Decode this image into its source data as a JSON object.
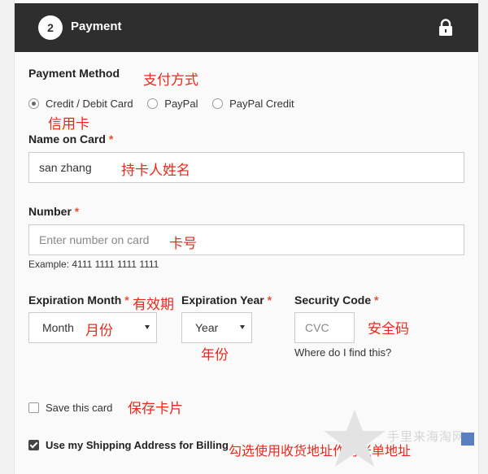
{
  "header": {
    "step_number": "2",
    "title": "Payment"
  },
  "payment_method": {
    "label": "Payment Method",
    "annotation": "支付方式",
    "options": [
      {
        "label": "Credit / Debit Card",
        "selected": true
      },
      {
        "label": "PayPal",
        "selected": false
      },
      {
        "label": "PayPal Credit",
        "selected": false
      }
    ],
    "option_annotation": "信用卡"
  },
  "name_on_card": {
    "label": "Name on Card",
    "required_mark": "*",
    "value": "san zhang",
    "annotation": "持卡人姓名"
  },
  "number": {
    "label": "Number",
    "required_mark": "*",
    "placeholder": "Enter number on card",
    "annotation": "卡号",
    "example": "Example: 4111 1111 1111 1111"
  },
  "expiration_month": {
    "label": "Expiration Month",
    "required_mark": "*",
    "annotation": "有效期",
    "value": "Month",
    "value_annotation": "月份"
  },
  "expiration_year": {
    "label": "Expiration Year",
    "required_mark": "*",
    "value": "Year",
    "annotation": "年份"
  },
  "security_code": {
    "label": "Security Code",
    "required_mark": "*",
    "placeholder": "CVC",
    "annotation": "安全码",
    "help_link": "Where do I find this?"
  },
  "save_card": {
    "label": "Save this card",
    "checked": false,
    "annotation": "保存卡片"
  },
  "use_shipping": {
    "label": "Use my Shipping Address for Billing",
    "checked": true,
    "annotation": "勾选使用收货地址作为账单地址"
  },
  "watermark": {
    "text": "手里来海淘网"
  },
  "colors": {
    "header_bg": "#2e2e2e",
    "required": "#e0542f",
    "annotation": "#e62a1e"
  }
}
